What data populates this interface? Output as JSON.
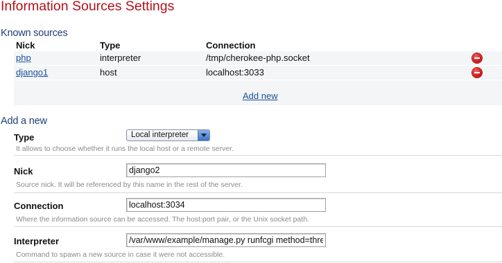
{
  "page": {
    "title": "Information Sources Settings"
  },
  "known_sources": {
    "title": "Known sources",
    "columns": [
      "Nick",
      "Type",
      "Connection"
    ],
    "rows": [
      {
        "nick": "php",
        "type": "interpreter",
        "connection": "/tmp/cherokee-php.socket"
      },
      {
        "nick": "django1",
        "type": "host",
        "connection": "localhost:3033"
      }
    ],
    "add_new_label": "Add new",
    "delete_icon": "delete-icon",
    "delete_color": "#d21f1f"
  },
  "add_new": {
    "title": "Add a new",
    "type": {
      "label": "Type",
      "value": "Local interpreter",
      "help": "It allows to choose whether it runs the local host or a remote server."
    },
    "nick": {
      "label": "Nick",
      "value": "django2",
      "help": "Source nick. It will be referenced by this name in the rest of the server."
    },
    "connection": {
      "label": "Connection",
      "value": "localhost:3034",
      "help": "Where the information source can be accessed. The host:port pair, or the Unix socket path."
    },
    "interpreter": {
      "label": "Interpreter",
      "value": "/var/www/example/manage.py runfcgi method=threaded",
      "help": "Command to spawn a new source in case it were not accessible."
    }
  },
  "colors": {
    "title_red": "#b4101a",
    "section_blue": "#1d3f78",
    "link_blue": "#1a4f9e"
  }
}
